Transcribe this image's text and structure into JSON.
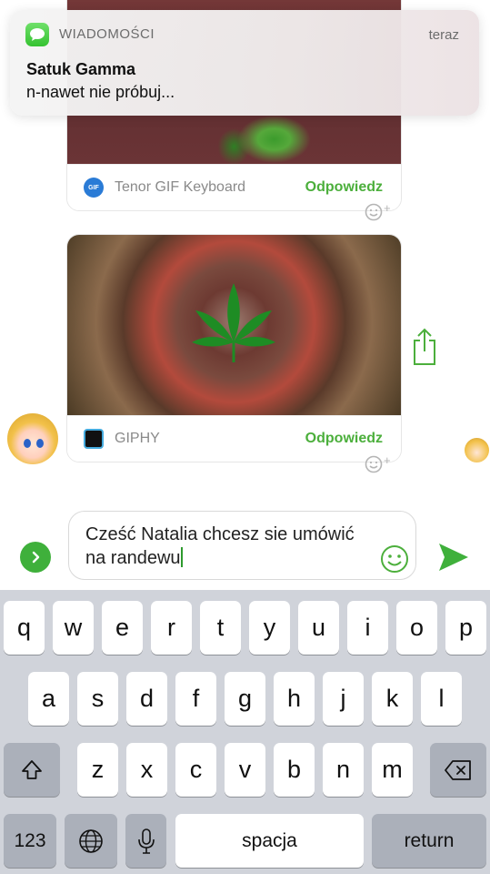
{
  "notification": {
    "app_name": "WIADOMOŚCI",
    "time": "teraz",
    "title": "Satuk Gamma",
    "body": "n-nawet nie próbuj..."
  },
  "messages": [
    {
      "source": "Tenor GIF Keyboard",
      "source_logo_text": "GIF",
      "reply_label": "Odpowiedz"
    },
    {
      "source": "GIPHY",
      "reply_label": "Odpowiedz"
    }
  ],
  "compose": {
    "text": "Cześć Natalia chcesz sie umówić na randewu"
  },
  "keyboard": {
    "row1": [
      "q",
      "w",
      "e",
      "r",
      "t",
      "y",
      "u",
      "i",
      "o",
      "p"
    ],
    "row2": [
      "a",
      "s",
      "d",
      "f",
      "g",
      "h",
      "j",
      "k",
      "l"
    ],
    "row3": [
      "z",
      "x",
      "c",
      "v",
      "b",
      "n",
      "m"
    ],
    "numbers_key": "123",
    "space_key": "spacja",
    "return_key": "return"
  },
  "icons": {
    "app": "messages-icon",
    "share": "share-icon",
    "emoji": "emoji-icon",
    "send": "send-icon",
    "expand": "chevron-right-icon",
    "shift": "shift-icon",
    "backspace": "backspace-icon",
    "globe": "globe-icon",
    "mic": "microphone-icon",
    "reaction": "add-reaction-icon",
    "gif_overlay": "cannabis-leaf-icon"
  },
  "colors": {
    "accent_green": "#4caf3c",
    "keyboard_bg": "#d0d3da",
    "dark_key": "#abb0ba"
  }
}
